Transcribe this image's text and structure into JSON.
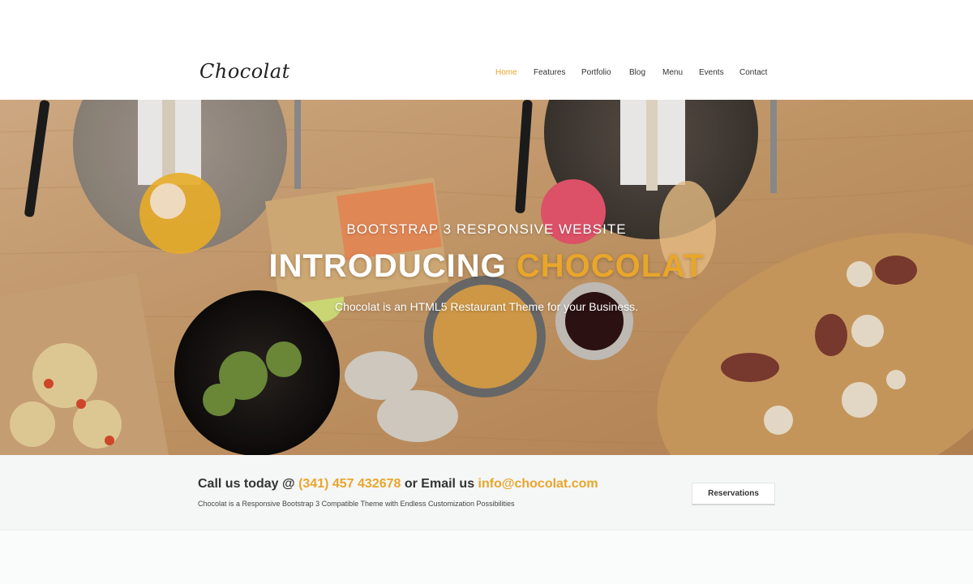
{
  "brand": {
    "logo_text": "Chocolat"
  },
  "nav": {
    "items": [
      {
        "label": "Home",
        "active": true
      },
      {
        "label": "Features",
        "active": false
      },
      {
        "label": "Portfolio",
        "active": false
      },
      {
        "label": "Blog",
        "active": false
      },
      {
        "label": "Menu",
        "active": false
      },
      {
        "label": "Events",
        "active": false
      },
      {
        "label": "Contact",
        "active": false
      }
    ]
  },
  "hero": {
    "subtitle": "BOOTSTRAP 3 RESPONSIVE WEBSITE",
    "title_main": "INTRODUCING ",
    "title_accent": "CHOCOLAT",
    "description": "Chocolat is an HTML5 Restaurant Theme for your Business."
  },
  "callband": {
    "prefix": "Call us today @ ",
    "phone": "(341) 457 432678",
    "middle": " or Email us ",
    "email": "info@chocolat.com",
    "tagline": "Chocolat is a Responsive Bootstrap 3 Compatible Theme with Endless Customization Possibilities",
    "button_label": "Reservations"
  },
  "colors": {
    "accent": "#e8a62b",
    "text": "#333333",
    "band_bg": "#f5f6f6"
  }
}
